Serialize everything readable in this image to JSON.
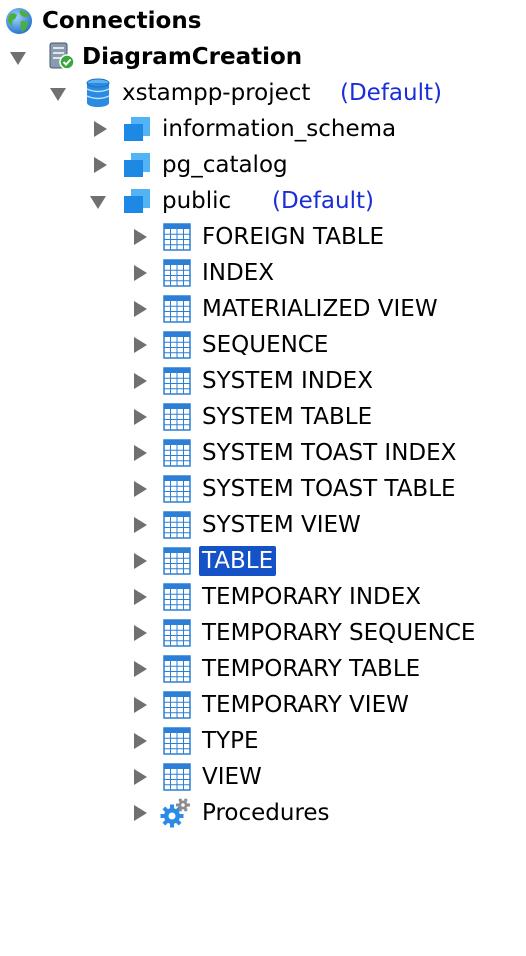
{
  "tree": {
    "root": {
      "label": "Connections",
      "icon": "globe-icon"
    },
    "connection": {
      "label": "DiagramCreation",
      "icon": "server-connected-icon",
      "expanded": true
    },
    "database": {
      "label": "xstampp-project",
      "tag": "(Default)",
      "icon": "database-icon",
      "expanded": true
    },
    "schemas": [
      {
        "label": "information_schema",
        "icon": "schema-icon",
        "expanded": false,
        "tag": ""
      },
      {
        "label": "pg_catalog",
        "icon": "schema-icon",
        "expanded": false,
        "tag": ""
      },
      {
        "label": "public",
        "icon": "schema-icon",
        "expanded": true,
        "tag": "(Default)"
      }
    ],
    "public_children": [
      {
        "label": "FOREIGN TABLE",
        "icon": "table-grid-icon",
        "selected": false
      },
      {
        "label": "INDEX",
        "icon": "table-grid-icon",
        "selected": false
      },
      {
        "label": "MATERIALIZED VIEW",
        "icon": "table-grid-icon",
        "selected": false
      },
      {
        "label": "SEQUENCE",
        "icon": "table-grid-icon",
        "selected": false
      },
      {
        "label": "SYSTEM INDEX",
        "icon": "table-grid-icon",
        "selected": false
      },
      {
        "label": "SYSTEM TABLE",
        "icon": "table-grid-icon",
        "selected": false
      },
      {
        "label": "SYSTEM TOAST INDEX",
        "icon": "table-grid-icon",
        "selected": false
      },
      {
        "label": "SYSTEM TOAST TABLE",
        "icon": "table-grid-icon",
        "selected": false
      },
      {
        "label": "SYSTEM VIEW",
        "icon": "table-grid-icon",
        "selected": false
      },
      {
        "label": "TABLE",
        "icon": "table-grid-icon",
        "selected": true
      },
      {
        "label": "TEMPORARY INDEX",
        "icon": "table-grid-icon",
        "selected": false
      },
      {
        "label": "TEMPORARY SEQUENCE",
        "icon": "table-grid-icon",
        "selected": false
      },
      {
        "label": "TEMPORARY TABLE",
        "icon": "table-grid-icon",
        "selected": false
      },
      {
        "label": "TEMPORARY VIEW",
        "icon": "table-grid-icon",
        "selected": false
      },
      {
        "label": "TYPE",
        "icon": "table-grid-icon",
        "selected": false
      },
      {
        "label": "VIEW",
        "icon": "table-grid-icon",
        "selected": false
      },
      {
        "label": "Procedures",
        "icon": "procedures-gear-icon",
        "selected": false
      }
    ]
  },
  "colors": {
    "selection_bg": "#1551c7",
    "default_tag": "#1a2ed8",
    "arrow": "#707070",
    "table_icon": "#2b7fd6"
  }
}
